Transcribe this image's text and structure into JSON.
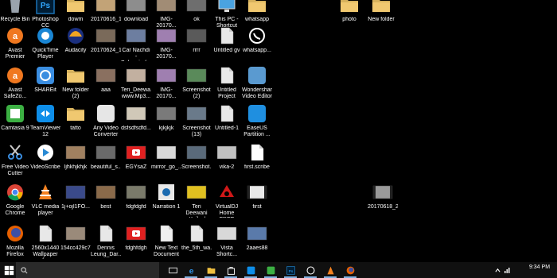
{
  "desktop_icons": [
    {
      "label": "Recycle Bin",
      "icon": "recycle-bin-icon",
      "color": "#9aa3ad"
    },
    {
      "label": "Photoshop\nCC",
      "icon": "photoshop-icon",
      "color": "#1b73b5"
    },
    {
      "label": "dowm",
      "icon": "folder-icon",
      "color": "#d7b25d"
    },
    {
      "label": "20170616_1...",
      "icon": "image-thumb-icon",
      "color": "#c2a377"
    },
    {
      "label": "download",
      "icon": "image-thumb-icon",
      "color": "#8d8d8d"
    },
    {
      "label": "IMG-20170...",
      "icon": "image-thumb-icon",
      "color": "#a18c75"
    },
    {
      "label": "ok",
      "icon": "image-thumb-icon",
      "color": "#6e6e6e"
    },
    {
      "label": "This PC -\nShortcut",
      "icon": "this-pc-icon",
      "color": "#4aa3e0"
    },
    {
      "label": "whatsapp",
      "icon": "folder-icon",
      "color": "#d7b25d"
    },
    {
      "label": "photo",
      "icon": "folder-icon",
      "color": "#d7b25d"
    },
    {
      "label": "New folder",
      "icon": "folder-icon",
      "color": "#d7b25d"
    },
    {
      "label": "Avast\nPremier",
      "icon": "avast-icon",
      "color": "#f07820"
    },
    {
      "label": "QuickTime\nPlayer",
      "icon": "quicktime-icon",
      "color": "#1a86d4"
    },
    {
      "label": "Audacity",
      "icon": "audacity-icon",
      "color": "#f1a520"
    },
    {
      "label": "20170624_1...",
      "icon": "image-thumb-icon",
      "color": "#7a6a5a"
    },
    {
      "label": "Car Nachdi -\nBohemia (...",
      "icon": "image-thumb-icon",
      "color": "#6d7ea0"
    },
    {
      "label": "IMG-20170...",
      "icon": "image-thumb-icon",
      "color": "#9f7fb0"
    },
    {
      "label": "rrrr",
      "icon": "image-thumb-icon",
      "color": "#5a5a5a"
    },
    {
      "label": "Untitled gv",
      "icon": "document-icon",
      "color": "#e8e8e8"
    },
    {
      "label": "whatsapp...",
      "icon": "whatsapp-icon",
      "color": "#ffffff"
    },
    {
      "label": "Avast\nSafeZo...",
      "icon": "avast-safezone-icon",
      "color": "#f07820"
    },
    {
      "label": "SHAREit",
      "icon": "shareit-icon",
      "color": "#3a8de0"
    },
    {
      "label": "New folder\n(2)",
      "icon": "folder-icon",
      "color": "#d7b25d"
    },
    {
      "label": "aaa",
      "icon": "image-thumb-icon",
      "color": "#8a7060"
    },
    {
      "label": "Teri_Deewa...\nwww.Mp3...",
      "icon": "image-thumb-icon",
      "color": "#c2b0a0"
    },
    {
      "label": "IMG-20170...",
      "icon": "image-thumb-icon",
      "color": "#9f7fb0"
    },
    {
      "label": "Screenshot\n(2)",
      "icon": "image-thumb-icon",
      "color": "#5a8a5a"
    },
    {
      "label": "Untitled\nProject",
      "icon": "document-icon",
      "color": "#e8e8e8"
    },
    {
      "label": "Wondershare\nVideo Editor",
      "icon": "wondershare-icon",
      "color": "#5a9ad0"
    },
    {
      "label": "Camtasia 9",
      "icon": "camtasia-icon",
      "color": "#3cb043"
    },
    {
      "label": "TeamViewer\n12",
      "icon": "teamviewer-icon",
      "color": "#0e8ee9"
    },
    {
      "label": "tatto",
      "icon": "folder-icon",
      "color": "#d7b25d"
    },
    {
      "label": "Any Video\nConverter",
      "icon": "video-converter-icon",
      "color": "#e6e6e6"
    },
    {
      "label": "dsfsdfsdfd...",
      "icon": "image-thumb-icon",
      "color": "#d0c8b8"
    },
    {
      "label": "kjkjkjk",
      "icon": "image-thumb-icon",
      "color": "#7a7a7a"
    },
    {
      "label": "Screenshot\n(13)",
      "icon": "image-thumb-icon",
      "color": "#6a7a8a"
    },
    {
      "label": "Untitled-1",
      "icon": "document-icon",
      "color": "#e8e8e8"
    },
    {
      "label": "EaseUS\nPartition ...",
      "icon": "easeus-icon",
      "color": "#1f8fe0"
    },
    {
      "label": "Free Video\nCutter",
      "icon": "scissors-icon",
      "color": "#3a8de0"
    },
    {
      "label": "VideoScribe",
      "icon": "videoscribe-icon",
      "color": "#2a8ad4"
    },
    {
      "label": "ljhkhjkhjk",
      "icon": "image-thumb-icon",
      "color": "#a08060"
    },
    {
      "label": "beautiful_s...",
      "icon": "image-thumb-icon",
      "color": "#6a6a6a"
    },
    {
      "label": "EGYsaZ",
      "icon": "youtube-thumb-icon",
      "color": "#e02020"
    },
    {
      "label": "mirror_go_...",
      "icon": "image-thumb-icon",
      "color": "#d8d8d8"
    },
    {
      "label": "Screenshot...",
      "icon": "image-thumb-icon",
      "color": "#5a6a7a"
    },
    {
      "label": "vika-2",
      "icon": "image-thumb-icon",
      "color": "#c0c0c0"
    },
    {
      "label": "first.scribe",
      "icon": "document-icon",
      "color": "#ffffff"
    },
    {
      "label": "Google\nChrome",
      "icon": "chrome-icon",
      "color": "#db4437"
    },
    {
      "label": "VLC media\nplayer",
      "icon": "vlc-icon",
      "color": "#f58220"
    },
    {
      "label": "1j+ojl1FO...",
      "icon": "image-thumb-icon",
      "color": "#3a4a8a"
    },
    {
      "label": "best",
      "icon": "image-thumb-icon",
      "color": "#8a6a4a"
    },
    {
      "label": "fdgfdgfd",
      "icon": "image-thumb-icon",
      "color": "#7a7a6a"
    },
    {
      "label": "Narration 1",
      "icon": "narration-icon",
      "color": "#e8e8e8"
    },
    {
      "label": "Teri Deewani\n- Kailash K...",
      "icon": "dj-thumb-icon",
      "color": "#e0c020"
    },
    {
      "label": "VirtualDJ\nHome FREE",
      "icon": "virtualdj-icon",
      "color": "#d01818"
    },
    {
      "label": "first",
      "icon": "video-thumb-icon",
      "color": "#e8e8e8"
    },
    {
      "label": "20170618_2...",
      "icon": "video-thumb-icon",
      "color": "#9a9a9a"
    },
    {
      "label": "Mozilla\nFirefox",
      "icon": "firefox-icon",
      "color": "#e66000"
    },
    {
      "label": "2560x1440\nWallpaper f...",
      "icon": "document-icon",
      "color": "#e8e8e8"
    },
    {
      "label": "154cc429c7...",
      "icon": "image-thumb-icon",
      "color": "#9a8a7a"
    },
    {
      "label": "Dennis\nLeung_Dar...",
      "icon": "document-icon",
      "color": "#e8e8e8"
    },
    {
      "label": "fdghfdgh",
      "icon": "youtube-thumb-icon",
      "color": "#e02020"
    },
    {
      "label": "New Text\nDocument",
      "icon": "text-document-icon",
      "color": "#f0f0f0"
    },
    {
      "label": "the_5th_wa...",
      "icon": "document-icon",
      "color": "#e8e8e8"
    },
    {
      "label": "Vista\nShortc...",
      "icon": "image-thumb-icon",
      "color": "#d8d8d8"
    },
    {
      "label": "2aaes88",
      "icon": "image-thumb-icon",
      "color": "#5a7aaa"
    }
  ],
  "taskbar": {
    "search_placeholder": "",
    "pinned": [
      {
        "name": "task-view-icon",
        "color": "#ffffff"
      },
      {
        "name": "edge-icon",
        "color": "#2e8ee0"
      },
      {
        "name": "file-explorer-icon",
        "color": "#f0c040"
      },
      {
        "name": "store-icon",
        "color": "#ffffff"
      },
      {
        "name": "teamviewer-icon",
        "color": "#0e8ee9"
      },
      {
        "name": "camtasia-icon",
        "color": "#3cb043"
      },
      {
        "name": "photoshop-icon",
        "color": "#1b73b5"
      },
      {
        "name": "whatsapp-icon",
        "color": "#ffffff"
      },
      {
        "name": "vlc-icon",
        "color": "#f58220"
      },
      {
        "name": "firefox-icon",
        "color": "#e66000"
      }
    ],
    "clock_time": "9:34 PM"
  }
}
